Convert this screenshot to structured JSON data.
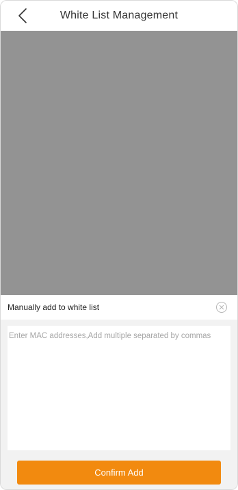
{
  "header": {
    "title": "White List Management",
    "back_icon": "chevron-left-icon"
  },
  "sheet": {
    "title": "Manually add to white list",
    "close_icon": "close-circle-icon",
    "input": {
      "value": "",
      "placeholder": "Enter MAC addresses,Add multiple separated by commas"
    },
    "confirm_label": "Confirm Add"
  },
  "colors": {
    "accent": "#f28a0f",
    "overlay": "#939393",
    "sheet_background": "#f2f2f2",
    "title_text": "#333333",
    "placeholder_text": "#a6a6a6"
  }
}
